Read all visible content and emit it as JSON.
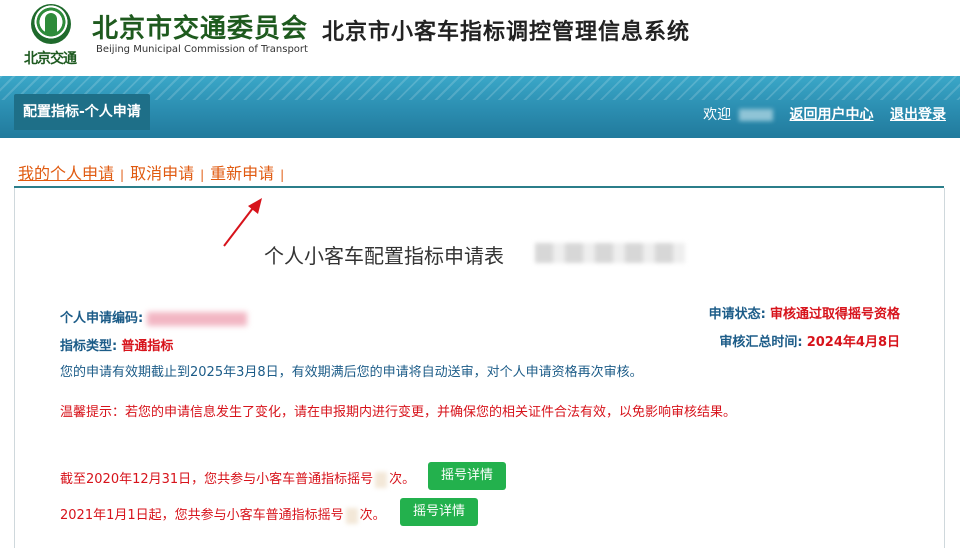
{
  "header": {
    "logo_text": "北京交通",
    "org_name_cn": "北京市交通委员会",
    "org_name_en": "Beijing Municipal Commission of Transport",
    "system_title": "北京市小客车指标调控管理信息系统"
  },
  "nav": {
    "active_tab": "配置指标-个人申请",
    "welcome": "欢迎",
    "user_center": "返回用户中心",
    "logout": "退出登录"
  },
  "subtabs": {
    "my_application": "我的个人申请",
    "cancel_application": "取消申请",
    "reapply": "重新申请",
    "separator": "|"
  },
  "form": {
    "title": "个人小客车配置指标申请表",
    "application_code_label": "个人申请编码:",
    "indicator_type_label": "指标类型:",
    "indicator_type_value": "普通指标",
    "status_label": "申请状态:",
    "status_value": "审核通过取得摇号资格",
    "review_time_label": "审核汇总时间:",
    "review_time_value": "2024年4月8日",
    "validity_note": "您的申请有效期截止到2025年3月8日，有效期满后您的申请将自动送审，对个人申请资格再次审核。",
    "reminder": "温馨提示：若您的申请信息发生了变化，请在申报期内进行变更，并确保您的相关证件合法有效，以免影响审核结果。"
  },
  "lottery": {
    "before_2021_prefix": "截至2020年12月31日，您共参与小客车普通指标摇号",
    "after_2021_prefix": "2021年1月1日起，您共参与小客车普通指标摇号",
    "suffix": "次。",
    "detail_button": "摇号详情"
  },
  "colors": {
    "nav_bg": "#2b8db0",
    "accent_orange": "#e05a10",
    "label_blue": "#1c5c88",
    "value_red": "#d7131b",
    "button_green": "#23b14d"
  }
}
